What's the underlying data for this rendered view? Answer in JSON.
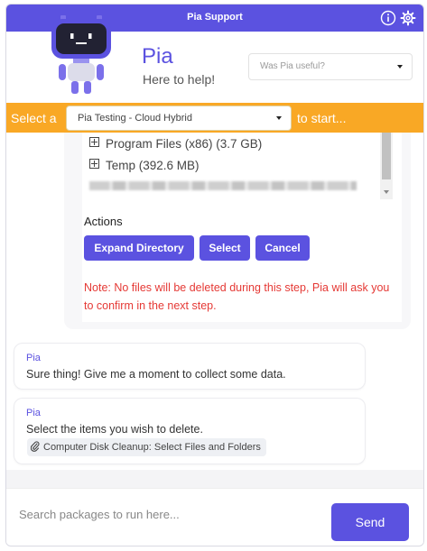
{
  "app": {
    "title": "Pia Support"
  },
  "header": {
    "name": "Pia",
    "subtitle": "Here to help!",
    "feedback_placeholder": "Was Pia useful?"
  },
  "selector": {
    "prefix": "Select a",
    "selected": "Pia Testing - Cloud Hybrid",
    "suffix": "to start..."
  },
  "file_tree": {
    "items": [
      {
        "label": "Program Files (x86) (3.7 GB)"
      },
      {
        "label": "Temp (392.6 MB)"
      }
    ]
  },
  "actions": {
    "label": "Actions",
    "buttons": {
      "expand": "Expand Directory",
      "select": "Select",
      "cancel": "Cancel"
    },
    "note": "Note: No files will be deleted during this step, Pia will ask you to confirm in the next step."
  },
  "messages": [
    {
      "sender": "Pia",
      "text": "Sure thing! Give me a moment to collect some data."
    },
    {
      "sender": "Pia",
      "text": "Select the items you wish to delete.",
      "chip": "Computer Disk Cleanup: Select Files and Folders"
    }
  ],
  "footer": {
    "search_placeholder": "Search packages to run here...",
    "send_label": "Send"
  },
  "colors": {
    "primary": "#5b52e0",
    "accent": "#f9a825",
    "note": "#e53935"
  }
}
